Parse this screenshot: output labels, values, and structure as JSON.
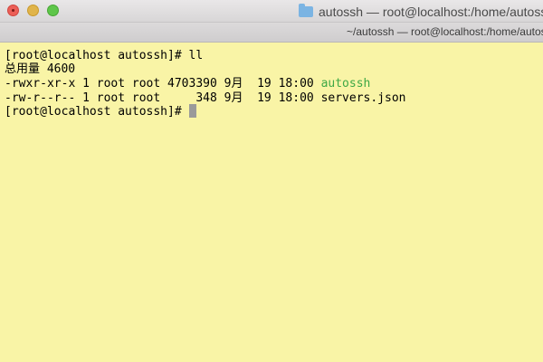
{
  "window": {
    "title": "autossh — root@localhost:/home/autossh",
    "tab_label": "~/autossh — root@localhost:/home/autossh",
    "title_icon": "folder-icon",
    "traffic_lights": [
      "close",
      "minimize",
      "zoom"
    ]
  },
  "colors": {
    "background": "#f9f4a6",
    "text": "#000000",
    "executable": "#3ea845",
    "cursor": "#9a9a9a"
  },
  "terminal": {
    "prompt": "[root@localhost autossh]#",
    "command": "ll",
    "total_line": "总用量 4600",
    "files": [
      {
        "meta": "-rwxr-xr-x 1 root root 4703390 9月  19 18:00",
        "name": "autossh",
        "is_executable": true
      },
      {
        "meta": "-rw-r--r-- 1 root root     348 9月  19 18:00",
        "name": "servers.json",
        "is_executable": false
      }
    ],
    "current_prompt": "[root@localhost autossh]#"
  }
}
